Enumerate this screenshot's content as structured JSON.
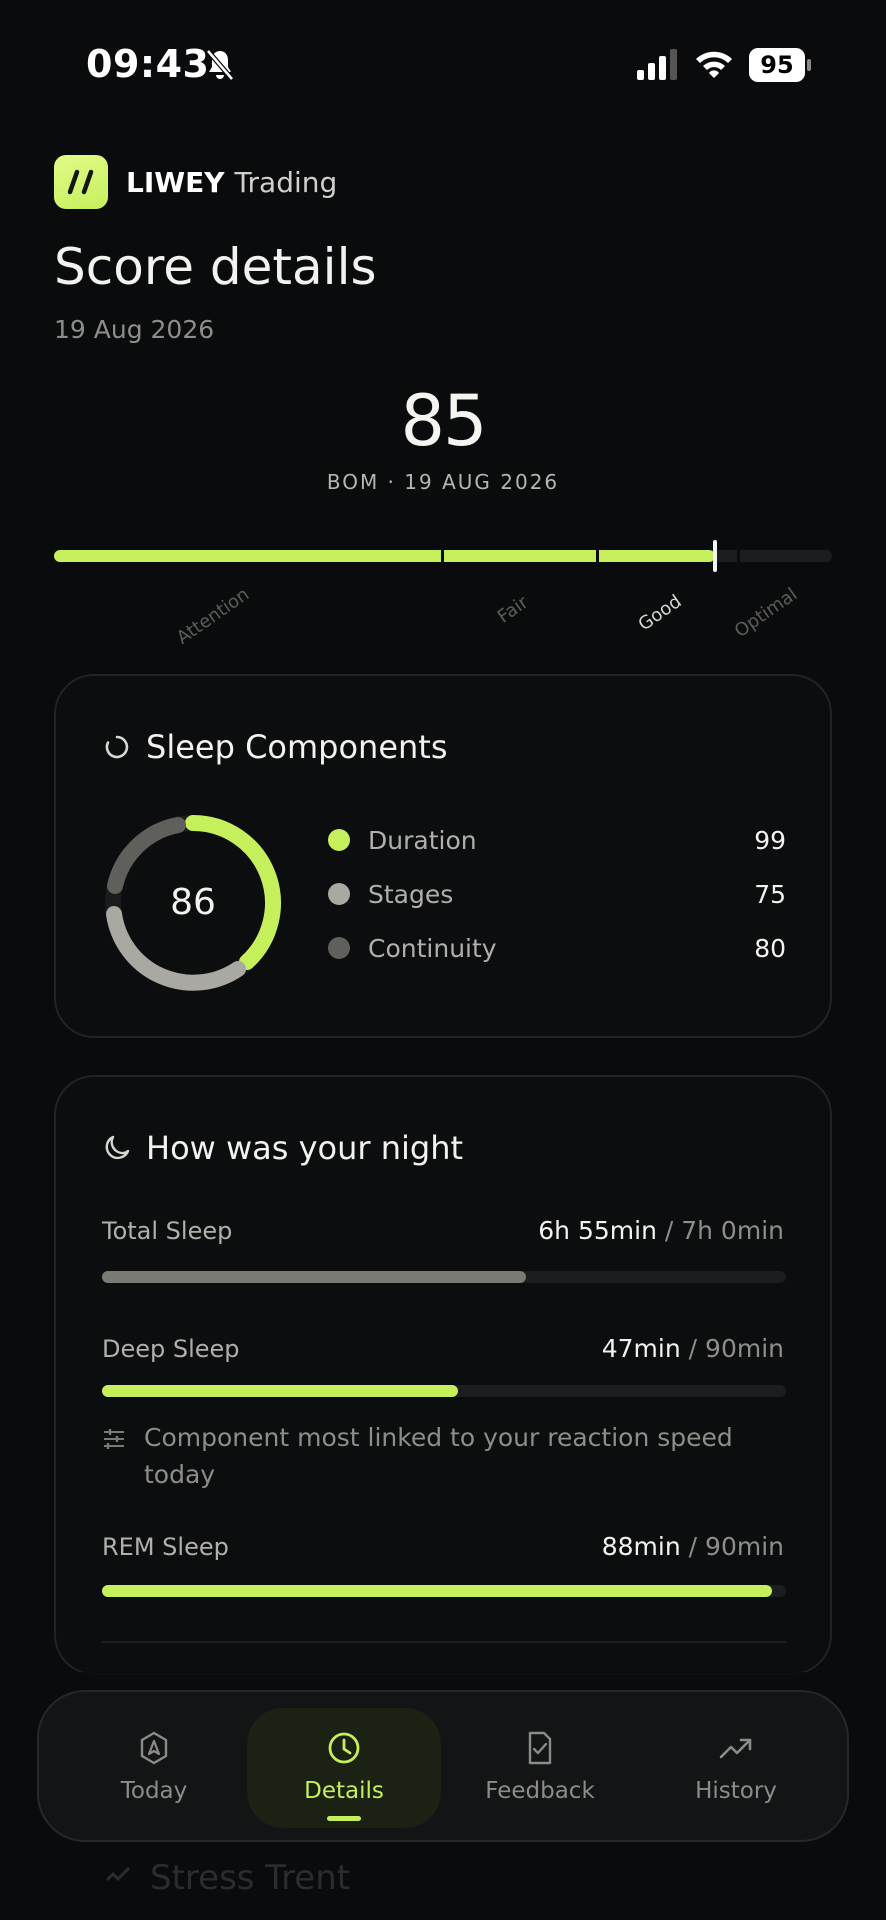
{
  "status_bar": {
    "time": "09:43",
    "battery": "95"
  },
  "brand": {
    "name": "LIWEY",
    "sub": "Trading"
  },
  "page": {
    "title": "Score details",
    "date": "19 Aug 2026"
  },
  "score": {
    "value": "85",
    "subtitle": "BOM · 19 AUG 2026",
    "fill_fraction": 0.85,
    "zones": [
      "Attention",
      "Fair",
      "Good",
      "Optimal"
    ],
    "active_zone": "Good"
  },
  "components": {
    "title": "Sleep Components",
    "overall": "86",
    "items": [
      {
        "label": "Duration",
        "value": "99",
        "color": "#c6ef5c"
      },
      {
        "label": "Stages",
        "value": "75",
        "color": "#a9a9a1"
      },
      {
        "label": "Continuity",
        "value": "80",
        "color": "#5f605c"
      }
    ]
  },
  "night": {
    "title": "How was your night",
    "metrics": [
      {
        "label": "Total Sleep",
        "value": "6h 55min",
        "target": " / 7h 0min",
        "fraction": 0.62,
        "color": "#7a7a74"
      },
      {
        "label": "Deep Sleep",
        "value": "47min",
        "target": " / 90min",
        "fraction": 0.52,
        "color": "#c6ef5c"
      },
      {
        "label": "REM Sleep",
        "value": "88min",
        "target": " / 90min",
        "fraction": 0.98,
        "color": "#c6ef5c"
      }
    ],
    "note": "Component most linked to your reaction speed today"
  },
  "next_section": {
    "title": "Stress Trent"
  },
  "tabs": [
    {
      "label": "Today",
      "icon": "compass-icon"
    },
    {
      "label": "Details",
      "icon": "clock-icon",
      "active": true
    },
    {
      "label": "Feedback",
      "icon": "clipboard-check-icon"
    },
    {
      "label": "History",
      "icon": "trend-up-icon"
    }
  ],
  "colors": {
    "accent": "#c6ef5c",
    "background": "#0a0b0c"
  }
}
